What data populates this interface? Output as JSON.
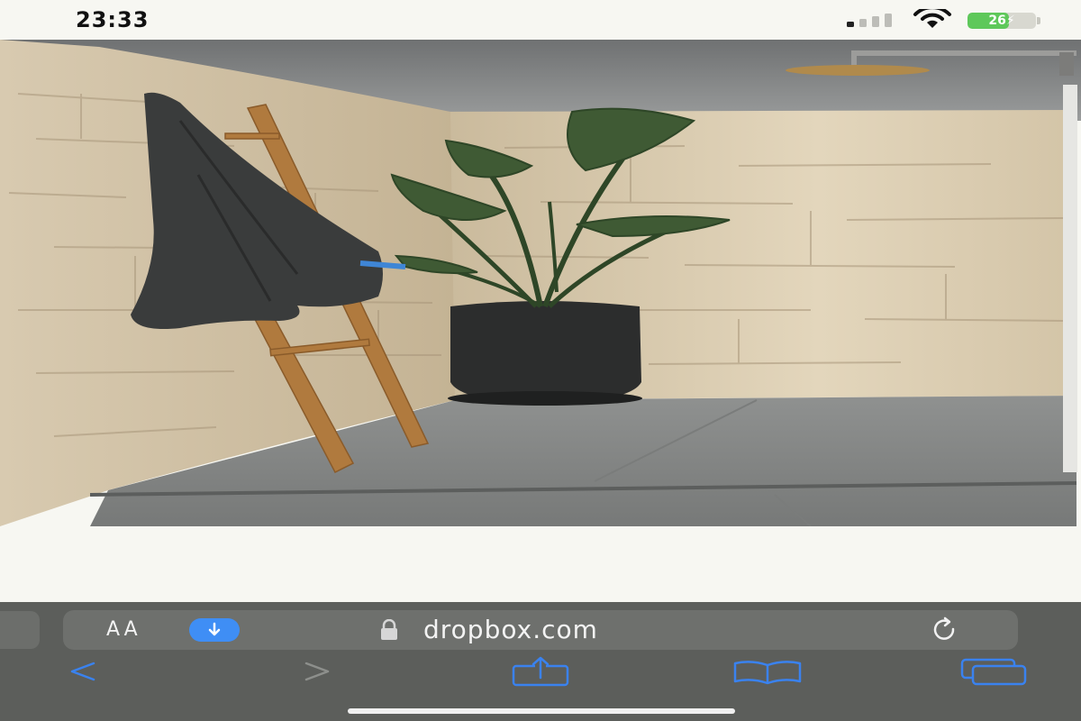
{
  "status_bar": {
    "time": "23:33",
    "battery_level": "26",
    "battery_color": "#5ec85a",
    "signal_icon": "signal-bars-icon",
    "wifi_icon": "wifi-icon"
  },
  "photo": {
    "icon": "photo-image"
  },
  "browser": {
    "aa_label": "AA",
    "url": "dropbox.com",
    "lock_icon": "lock-icon",
    "download_icon": "download-icon",
    "reload_icon": "reload-icon",
    "accent_color": "#3f8ef5"
  },
  "toolbar": {
    "back_icon": "chevron-left-icon",
    "forward_icon": "chevron-right-icon",
    "share_icon": "share-icon",
    "bookmarks_icon": "book-icon",
    "tabs_icon": "tabs-icon",
    "tint_color": "#2f7ef0"
  }
}
